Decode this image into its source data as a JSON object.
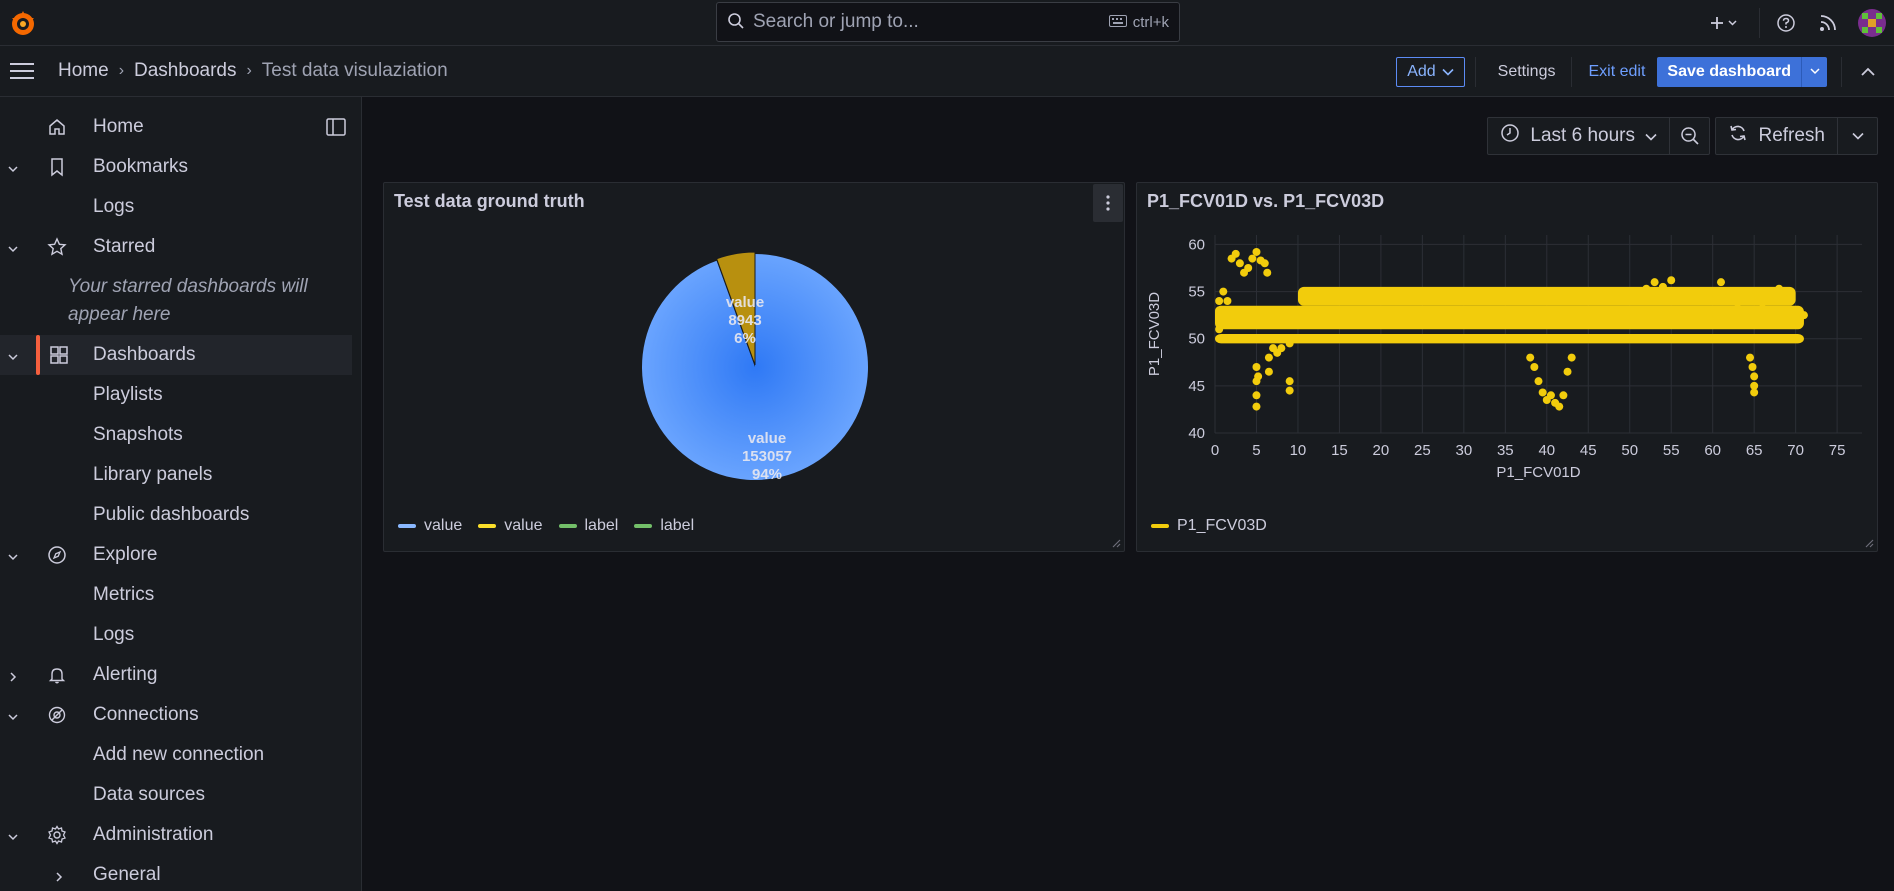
{
  "topbar": {
    "search": {
      "placeholder": "Search or jump to...",
      "shortcut": "ctrl+k"
    }
  },
  "breadcrumb": {
    "items": [
      "Home",
      "Dashboards"
    ],
    "current": "Test data visulaziation"
  },
  "toolbar": {
    "add_label": "Add",
    "settings_label": "Settings",
    "exit_edit_label": "Exit edit",
    "save_label": "Save dashboard"
  },
  "sidebar": {
    "starred_note": "Your starred dashboards will appear here",
    "items": [
      {
        "label": "Home",
        "icon": "home-icon",
        "chevron": "none"
      },
      {
        "label": "Bookmarks",
        "icon": "bookmark-icon",
        "chevron": "down"
      },
      {
        "label": "Logs",
        "sub": true
      },
      {
        "label": "Starred",
        "icon": "star-icon",
        "chevron": "down"
      },
      {
        "label": "Dashboards",
        "icon": "dashboards-icon",
        "chevron": "down",
        "active": true
      },
      {
        "label": "Playlists",
        "sub": true
      },
      {
        "label": "Snapshots",
        "sub": true
      },
      {
        "label": "Library panels",
        "sub": true
      },
      {
        "label": "Public dashboards",
        "sub": true
      },
      {
        "label": "Explore",
        "icon": "compass-icon",
        "chevron": "down"
      },
      {
        "label": "Metrics",
        "sub": true
      },
      {
        "label": "Logs",
        "sub": true
      },
      {
        "label": "Alerting",
        "icon": "bell-icon",
        "chevron": "right"
      },
      {
        "label": "Connections",
        "icon": "connections-icon",
        "chevron": "down"
      },
      {
        "label": "Add new connection",
        "sub": true
      },
      {
        "label": "Data sources",
        "sub": true
      },
      {
        "label": "Administration",
        "icon": "gear-icon",
        "chevron": "down"
      },
      {
        "label": "General",
        "sub": true,
        "chevron": "right"
      }
    ]
  },
  "timepicker": {
    "range_label": "Last 6 hours",
    "refresh_label": "Refresh"
  },
  "panels": {
    "pie": {
      "title": "Test data ground truth",
      "legend": [
        {
          "name": "value",
          "color": "#8ab8ff"
        },
        {
          "name": "value",
          "color": "#fade2a"
        },
        {
          "name": "label",
          "color": "#73bf69"
        },
        {
          "name": "label",
          "color": "#73bf69"
        }
      ]
    },
    "scatter": {
      "title": "P1_FCV01D vs. P1_FCV03D",
      "legend": [
        {
          "name": "P1_FCV03D",
          "color": "#f2cc0c"
        }
      ]
    }
  },
  "chart_data": [
    {
      "type": "pie",
      "title": "Test data ground truth",
      "slices": [
        {
          "name": "value",
          "value": 153057,
          "percent": "94%",
          "color": "#5794f2"
        },
        {
          "name": "value",
          "value": 8943,
          "percent": "6%",
          "color": "#b8900f"
        }
      ],
      "legend_placement": "bottom"
    },
    {
      "type": "scatter",
      "title": "P1_FCV01D vs. P1_FCV03D",
      "xlabel": "P1_FCV01D",
      "ylabel": "P1_FCV03D",
      "xlim": [
        0,
        78
      ],
      "ylim": [
        40,
        61
      ],
      "xticks": [
        0,
        5,
        10,
        15,
        20,
        25,
        30,
        35,
        40,
        45,
        50,
        55,
        60,
        65,
        70,
        75
      ],
      "yticks": [
        40,
        45,
        50,
        55,
        60
      ],
      "grid": true,
      "series": [
        {
          "name": "P1_FCV03D",
          "color": "#f2cc0c",
          "bands": [
            {
              "x": [
                0,
                71
              ],
              "y_lo": 51.0,
              "y_hi": 53.5
            },
            {
              "x": [
                0,
                71
              ],
              "y_lo": 49.5,
              "y_hi": 50.5
            },
            {
              "x": [
                10,
                70
              ],
              "y_lo": 53.5,
              "y_hi": 55.5
            }
          ],
          "points": [
            [
              2,
              58.5
            ],
            [
              2.5,
              59
            ],
            [
              3,
              58
            ],
            [
              3.5,
              57
            ],
            [
              4,
              57.5
            ],
            [
              4.5,
              58.5
            ],
            [
              5,
              59.2
            ],
            [
              5.5,
              58.3
            ],
            [
              6,
              58
            ],
            [
              6.3,
              57
            ],
            [
              5,
              47
            ],
            [
              5,
              45.5
            ],
            [
              5,
              44
            ],
            [
              5,
              42.8
            ],
            [
              5.2,
              46
            ],
            [
              6.5,
              48
            ],
            [
              6.5,
              46.5
            ],
            [
              7,
              49
            ],
            [
              7.5,
              48.5
            ],
            [
              8,
              49
            ],
            [
              9,
              49.5
            ],
            [
              9,
              45.5
            ],
            [
              9,
              44.5
            ],
            [
              38,
              48
            ],
            [
              38.5,
              47
            ],
            [
              39,
              45.5
            ],
            [
              39.5,
              44.3
            ],
            [
              40,
              43.5
            ],
            [
              40.5,
              44
            ],
            [
              41,
              43.2
            ],
            [
              41.5,
              42.8
            ],
            [
              42,
              44
            ],
            [
              42.5,
              46.5
            ],
            [
              43,
              48
            ],
            [
              64.5,
              48
            ],
            [
              64.8,
              47
            ],
            [
              65,
              46
            ],
            [
              65,
              45
            ],
            [
              65,
              44.3
            ],
            [
              0.5,
              51
            ],
            [
              0.5,
              53
            ],
            [
              0.5,
              54
            ],
            [
              1,
              55
            ],
            [
              1.5,
              54
            ],
            [
              70,
              53
            ],
            [
              70.5,
              52
            ],
            [
              71,
              52.5
            ],
            [
              69,
              55
            ],
            [
              68,
              55.3
            ],
            [
              67,
              54
            ],
            [
              66,
              53.8
            ],
            [
              53,
              56
            ],
            [
              54,
              55.5
            ],
            [
              55,
              56.2
            ],
            [
              52,
              55.3
            ],
            [
              61,
              56
            ],
            [
              62,
              54.5
            ],
            [
              63,
              53.8
            ]
          ]
        }
      ],
      "legend_placement": "bottom-left"
    }
  ]
}
